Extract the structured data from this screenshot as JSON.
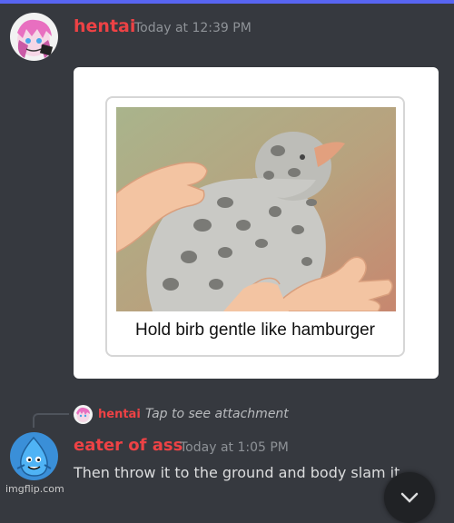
{
  "colors": {
    "background": "#36393f",
    "accent": "#5865f2",
    "username": "#ed4245",
    "timestamp": "#8e9297"
  },
  "messages": [
    {
      "username": "hentai",
      "timestamp": "Today at 12:39 PM",
      "avatar_icon": "anime-avatar-icon",
      "attachment": {
        "caption": "Hold birb gentle like hamburger"
      }
    },
    {
      "reply": {
        "username": "hentai",
        "text": "Tap to see attachment"
      },
      "username": "eater of ass",
      "timestamp": "Today at 1:05 PM",
      "avatar_icon": "blue-droplet-avatar-icon",
      "content": "Then throw it to the ground and body slam it"
    }
  ],
  "jump_button_icon": "chevron-down-icon",
  "watermark": "imgflip.com"
}
